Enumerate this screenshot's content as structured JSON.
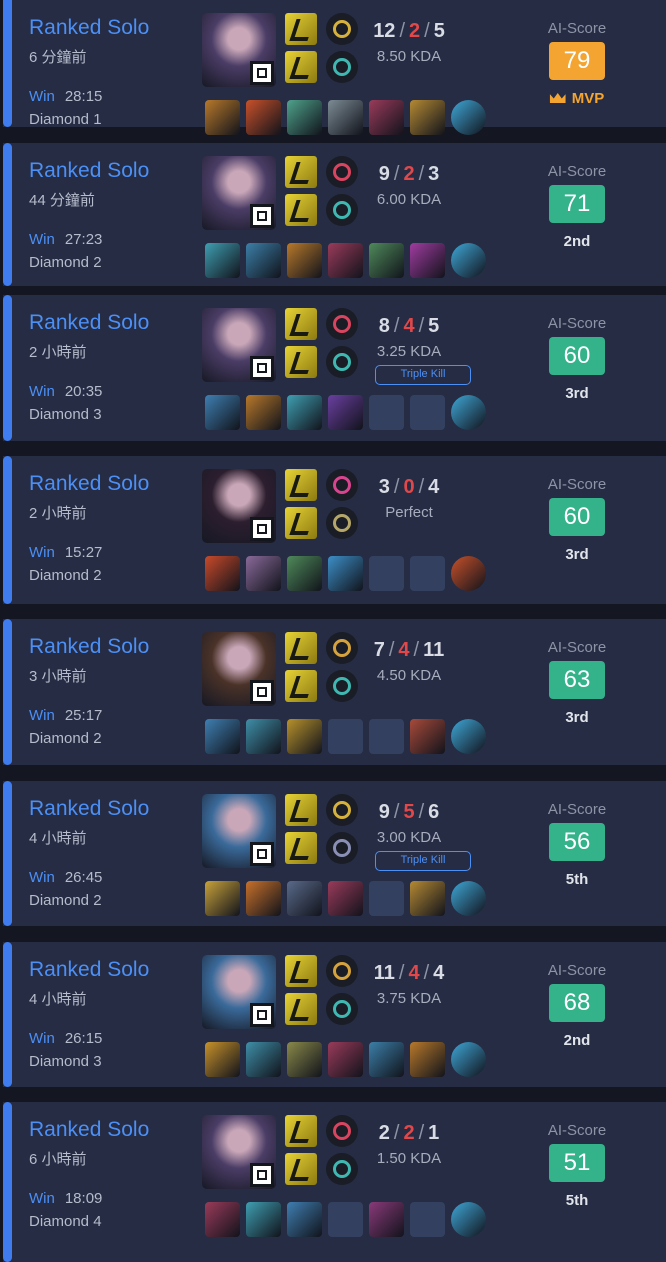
{
  "ai_score_label": "AI-Score",
  "matches": [
    {
      "queue": "Ranked Solo",
      "time_ago": "6 分鐘前",
      "result": "Win",
      "duration": "28:15",
      "tier": "Diamond 1",
      "kills": "12",
      "deaths": "2",
      "assists": "5",
      "kda_ratio": "8.50 KDA",
      "badge": "",
      "score": "79",
      "score_color": "#f4a531",
      "placement": "MVP",
      "is_mvp": true,
      "champion": "kaisa",
      "champ_color": "#4b3d66",
      "summoner_spells": [
        "flash",
        "ignite"
      ],
      "rune_colors": [
        "#d6b23c",
        "#3fb8b1"
      ],
      "item_colors": [
        "#b8792a",
        "#c8512a",
        "#4fa38c",
        "#7d8c95",
        "#9a3b5a",
        "#b58a33",
        "#3fa8d8"
      ]
    },
    {
      "queue": "Ranked Solo",
      "time_ago": "44 分鐘前",
      "result": "Win",
      "duration": "27:23",
      "tier": "Diamond 2",
      "kills": "9",
      "deaths": "2",
      "assists": "3",
      "kda_ratio": "6.00 KDA",
      "badge": "",
      "score": "71",
      "score_color": "#34b38a",
      "placement": "2nd",
      "is_mvp": false,
      "champion": "kaisa",
      "champ_color": "#4b3d66",
      "summoner_spells": [
        "flash",
        "ghost"
      ],
      "rune_colors": [
        "#d9445f",
        "#3fb8b1"
      ],
      "item_colors": [
        "#3f9fb2",
        "#3c7fa8",
        "#b8792a",
        "#9a3b5a",
        "#4f8a5a",
        "#a03ca0",
        "#3fa8d8"
      ]
    },
    {
      "queue": "Ranked Solo",
      "time_ago": "2 小時前",
      "result": "Win",
      "duration": "20:35",
      "tier": "Diamond 3",
      "kills": "8",
      "deaths": "4",
      "assists": "5",
      "kda_ratio": "3.25 KDA",
      "badge": "Triple Kill",
      "score": "60",
      "score_color": "#34b38a",
      "placement": "3rd",
      "is_mvp": false,
      "champion": "kaisa",
      "champ_color": "#4b3d66",
      "summoner_spells": [
        "flash",
        "ghost"
      ],
      "rune_colors": [
        "#d9445f",
        "#3fb8b1"
      ],
      "item_colors": [
        "#3f7fb2",
        "#b8792a",
        "#3f9fb2",
        "#6a3fa0",
        "#2e3a5a",
        "#2e3a5a",
        "#3fa8d8"
      ]
    },
    {
      "queue": "Ranked Solo",
      "time_ago": "2 小時前",
      "result": "Win",
      "duration": "15:27",
      "tier": "Diamond 2",
      "kills": "3",
      "deaths": "0",
      "assists": "4",
      "kda_ratio": "Perfect",
      "badge": "",
      "score": "60",
      "score_color": "#34b38a",
      "placement": "3rd",
      "is_mvp": false,
      "champion": "evelynn",
      "champ_color": "#2c1e2e",
      "summoner_spells": [
        "flash",
        "smite"
      ],
      "rune_colors": [
        "#d9448f",
        "#b5a76a"
      ],
      "item_colors": [
        "#c84a2a",
        "#8a6a9a",
        "#4f8a5a",
        "#3c8fc8",
        "#2e3a5a",
        "#2e3a5a",
        "#c8512a"
      ]
    },
    {
      "queue": "Ranked Solo",
      "time_ago": "3 小時前",
      "result": "Win",
      "duration": "25:17",
      "tier": "Diamond 2",
      "kills": "7",
      "deaths": "4",
      "assists": "11",
      "kda_ratio": "4.50 KDA",
      "badge": "",
      "score": "63",
      "score_color": "#34b38a",
      "placement": "3rd",
      "is_mvp": false,
      "champion": "lucian",
      "champ_color": "#4a3228",
      "summoner_spells": [
        "flash",
        "heal"
      ],
      "rune_colors": [
        "#d6a23c",
        "#3fb8b1"
      ],
      "item_colors": [
        "#3f7fb2",
        "#3f8fa8",
        "#b8922a",
        "#2e3a5a",
        "#2e3a5a",
        "#a84a3a",
        "#3fa8d8"
      ]
    },
    {
      "queue": "Ranked Solo",
      "time_ago": "4 小時前",
      "result": "Win",
      "duration": "26:45",
      "tier": "Diamond 2",
      "kills": "9",
      "deaths": "5",
      "assists": "6",
      "kda_ratio": "3.00 KDA",
      "badge": "Triple Kill",
      "score": "56",
      "score_color": "#34b38a",
      "placement": "5th",
      "is_mvp": false,
      "champion": "jinx",
      "champ_color": "#3a6a9a",
      "summoner_spells": [
        "flash",
        "heal"
      ],
      "rune_colors": [
        "#d6b23c",
        "#8a8fb5"
      ],
      "item_colors": [
        "#c8a23a",
        "#c8712a",
        "#5a6a8a",
        "#9a3b5a",
        "#2e3a5a",
        "#b58a33",
        "#3fa8d8"
      ]
    },
    {
      "queue": "Ranked Solo",
      "time_ago": "4 小時前",
      "result": "Win",
      "duration": "26:15",
      "tier": "Diamond 3",
      "kills": "11",
      "deaths": "4",
      "assists": "4",
      "kda_ratio": "3.75 KDA",
      "badge": "",
      "score": "68",
      "score_color": "#34b38a",
      "placement": "2nd",
      "is_mvp": false,
      "champion": "jinx",
      "champ_color": "#3a6a9a",
      "summoner_spells": [
        "flash",
        "heal"
      ],
      "rune_colors": [
        "#d6a23c",
        "#3fb8b1"
      ],
      "item_colors": [
        "#c8922a",
        "#3f8fa8",
        "#8a8a4a",
        "#9a3b5a",
        "#3c7fa8",
        "#b8792a",
        "#3fa8d8"
      ]
    },
    {
      "queue": "Ranked Solo",
      "time_ago": "6 小時前",
      "result": "Win",
      "duration": "18:09",
      "tier": "Diamond 4",
      "kills": "2",
      "deaths": "2",
      "assists": "1",
      "kda_ratio": "1.50 KDA",
      "badge": "",
      "score": "51",
      "score_color": "#34b38a",
      "placement": "5th",
      "is_mvp": false,
      "champion": "kaisa",
      "champ_color": "#4b3d66",
      "summoner_spells": [
        "flash",
        "ghost"
      ],
      "rune_colors": [
        "#d9445f",
        "#3fb8b1"
      ],
      "item_colors": [
        "#9a3b5a",
        "#3f9fb2",
        "#3f7fb2",
        "#2e3a5a",
        "#8a3a7a",
        "#2e3a5a",
        "#3fa8d8"
      ]
    }
  ]
}
